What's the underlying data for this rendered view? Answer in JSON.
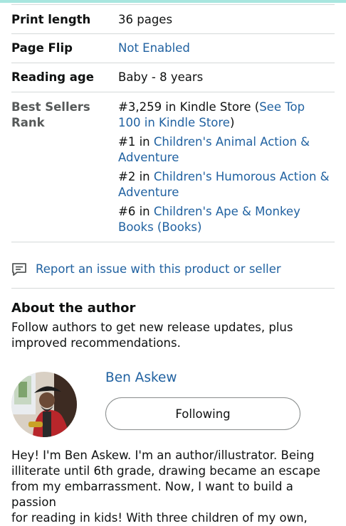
{
  "details": {
    "print_length": {
      "label": "Print length",
      "value": "36 pages"
    },
    "page_flip": {
      "label": "Page Flip",
      "value": "Not Enabled"
    },
    "reading_age": {
      "label": "Reading age",
      "value": "Baby - 8 years"
    },
    "best_sellers": {
      "label_line1": "Best Sellers",
      "label_line2": "Rank",
      "overall": {
        "rank": "#3,259 in Kindle Store (",
        "link_line1": "See Top",
        "link_line2": "100 in Kindle Store",
        "close": ")"
      },
      "categories": [
        {
          "rank": "#1 in ",
          "link_line1": "Children's Animal Action &",
          "link_line2": "Adventure"
        },
        {
          "rank": "#2 in ",
          "link_line1": "Children's Humorous Action &",
          "link_line2": "Adventure"
        },
        {
          "rank": "#6 in ",
          "link_line1": "Children's Ape & Monkey",
          "link_line2": "Books (Books)"
        }
      ]
    }
  },
  "report": {
    "label": "Report an issue with this product or seller",
    "icon": "report-comment-icon"
  },
  "about": {
    "title": "About the author",
    "description_line1": "Follow authors to get new release updates, plus",
    "description_line2": "improved recommendations."
  },
  "author": {
    "name": "Ben Askew",
    "follow_label": "Following",
    "bio_lines": [
      "Hey! I'm Ben Askew. I'm an author/illustrator. Being",
      "illiterate until 6th grade, drawing became an escape",
      "from my embarrassment. Now, I want to build a passion",
      "for reading in kids! With three children of my own,"
    ]
  },
  "colors": {
    "link": "#2162a1",
    "divider": "#d5d9d9",
    "text": "#0f1111",
    "muted": "#565959",
    "accent_line": "#a8e6df"
  }
}
